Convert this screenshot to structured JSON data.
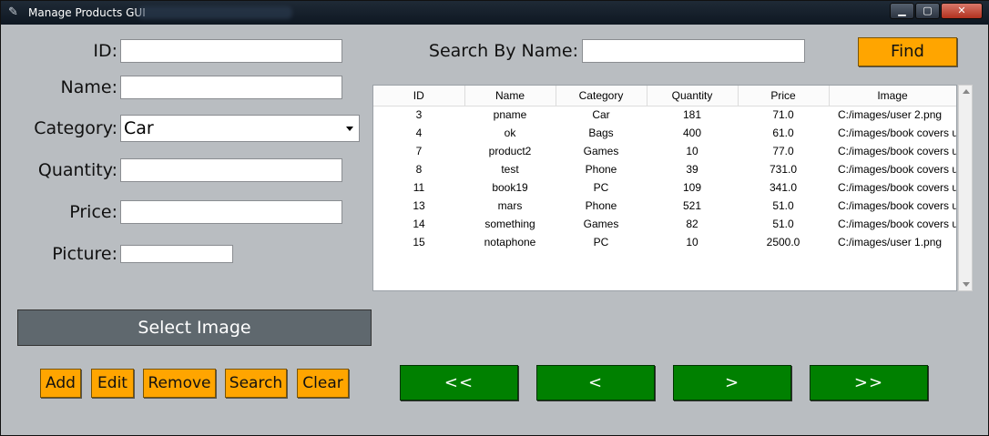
{
  "window": {
    "title": "Manage Products GUI",
    "min": "▁",
    "max": "▢",
    "close": "✕"
  },
  "form": {
    "id_label": "ID:",
    "name_label": "Name:",
    "category_label": "Category:",
    "category_value": "Car",
    "quantity_label": "Quantity:",
    "price_label": "Price:",
    "picture_label": "Picture:",
    "select_image": "Select Image"
  },
  "actions": {
    "add": "Add",
    "edit": "Edit",
    "remove": "Remove",
    "search": "Search",
    "clear": "Clear"
  },
  "search": {
    "label": "Search By Name:",
    "find": "Find"
  },
  "pager": {
    "first": "<<",
    "prev": "<",
    "next": ">",
    "last": ">>"
  },
  "table": {
    "columns": [
      "ID",
      "Name",
      "Category",
      "Quantity",
      "Price",
      "Image"
    ],
    "rows": [
      [
        "3",
        "pname",
        "Car",
        "181",
        "71.0",
        "C:/images/user 2.png"
      ],
      [
        "4",
        "ok",
        "Bags",
        "400",
        "61.0",
        "C:/images/book covers u"
      ],
      [
        "7",
        "product2",
        "Games",
        "10",
        "77.0",
        "C:/images/book covers u"
      ],
      [
        "8",
        "test",
        "Phone",
        "39",
        "731.0",
        "C:/images/book covers u"
      ],
      [
        "11",
        "book19",
        "PC",
        "109",
        "341.0",
        "C:/images/book covers u"
      ],
      [
        "13",
        "mars",
        "Phone",
        "521",
        "51.0",
        "C:/images/book covers u"
      ],
      [
        "14",
        "something",
        "Games",
        "82",
        "51.0",
        "C:/images/book covers u"
      ],
      [
        "15",
        "notaphone",
        "PC",
        "10",
        "2500.0",
        "C:/images/user 1.png"
      ]
    ]
  }
}
